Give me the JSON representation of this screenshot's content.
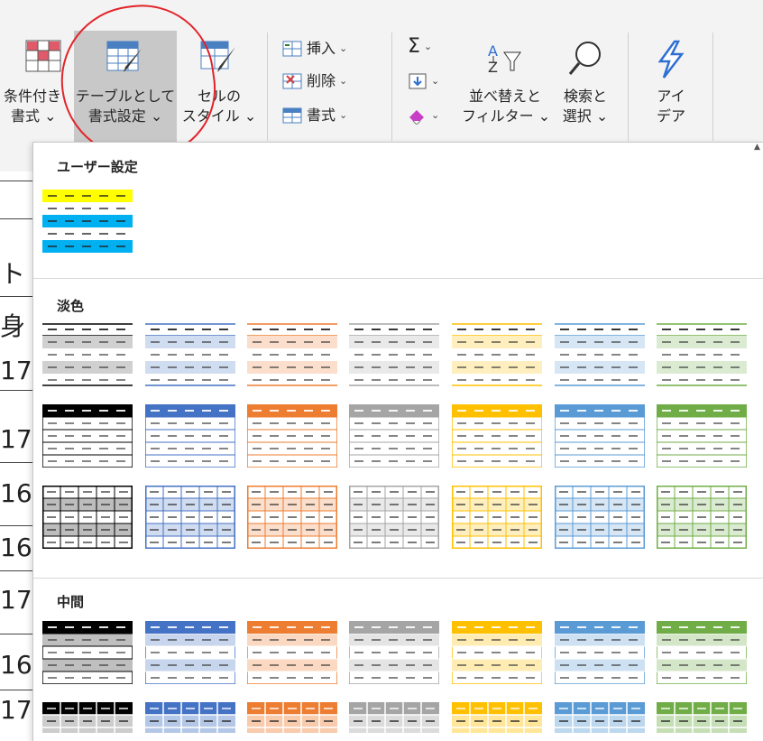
{
  "ribbon": {
    "conditional_format": {
      "line1": "条件付き",
      "line2": "書式 ⌄"
    },
    "format_as_table": {
      "line1": "テーブルとして",
      "line2": "書式設定 ⌄"
    },
    "cell_styles": {
      "line1": "セルの",
      "line2": "スタイル ⌄"
    },
    "insert_label": "挿入",
    "delete_label": "削除",
    "format_label": "書式",
    "sort_filter": {
      "line1": "並べ替えと",
      "line2": "フィルター ⌄"
    },
    "find_select": {
      "line1": "検索と",
      "line2": "選択 ⌄"
    },
    "ideas": {
      "line1": "アイ",
      "line2": "デア"
    }
  },
  "sheet": {
    "row_texts": [
      "ト",
      "身",
      "17",
      "17",
      "16",
      "16",
      "17",
      "16",
      "17"
    ]
  },
  "gallery": {
    "sections": {
      "custom": "ユーザー設定",
      "light": "淡色",
      "medium": "中間"
    }
  },
  "colors": {
    "black": "#000000",
    "blue": "#4472c4",
    "orange": "#ed7d31",
    "gray": "#a5a5a5",
    "gold": "#ffc000",
    "lightblue": "#5b9bd5",
    "green": "#70ad47",
    "custom_yellow": "#ffff00",
    "custom_blue": "#00b0f0"
  }
}
